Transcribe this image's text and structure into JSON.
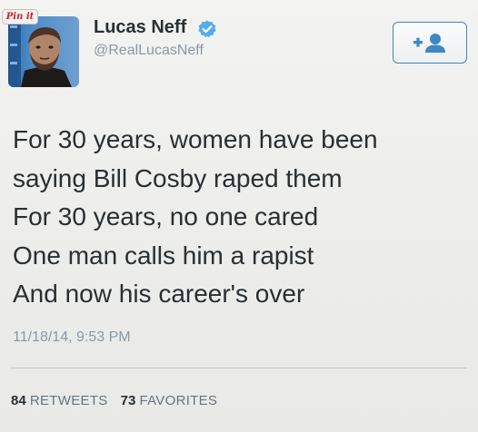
{
  "pin_button": {
    "label": "Pin it"
  },
  "tweet": {
    "author": {
      "name": "Lucas Neff",
      "handle": "@RealLucasNeff",
      "verified": true
    },
    "follow_button": {
      "icon": "add-user-icon",
      "accent": "#3b88c3"
    },
    "text_lines": [
      "For 30 years, women have been",
      "saying Bill Cosby raped them",
      "For 30 years, no one cared",
      "One man calls him a rapist",
      "And now his career's over"
    ],
    "timestamp": "11/18/14, 9:53 PM",
    "stats": {
      "retweets_count": "84",
      "retweets_label": "RETWEETS",
      "favorites_count": "73",
      "favorites_label": "FAVORITES"
    }
  },
  "colors": {
    "verified_badge": "#55acee",
    "link_accent": "#3b88c3",
    "muted_text": "#8899a6",
    "pin_red": "#cb2027"
  }
}
